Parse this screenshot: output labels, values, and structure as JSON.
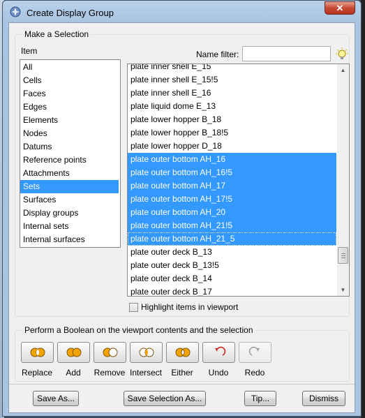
{
  "window": {
    "title": "Create Display Group",
    "close_label": "✕"
  },
  "selection_group": {
    "label": "Make a Selection",
    "item_label": "Item",
    "items": [
      "All",
      "Cells",
      "Faces",
      "Edges",
      "Elements",
      "Nodes",
      "Datums",
      "Reference points",
      "Attachments",
      "Sets",
      "Surfaces",
      "Display groups",
      "Internal sets",
      "Internal surfaces"
    ],
    "selected_item": "Sets",
    "name_filter_label": "Name filter:",
    "name_filter_value": "",
    "sets": [
      "plate inner shell E_15",
      "plate inner shell E_15!5",
      "plate inner shell E_16",
      "plate liquid dome E_13",
      "plate lower hopper B_18",
      "plate lower hopper B_18!5",
      "plate lower hopper D_18",
      "plate outer bottom AH_16",
      "plate outer bottom AH_16!5",
      "plate outer bottom AH_17",
      "plate outer bottom AH_17!5",
      "plate outer bottom AH_20",
      "plate outer bottom AH_21!5",
      "plate outer bottom AH_21_5",
      "plate outer deck B_13",
      "plate outer deck B_13!5",
      "plate outer deck B_14",
      "plate outer deck B_17"
    ],
    "selected_sets": [
      "plate outer bottom AH_16",
      "plate outer bottom AH_16!5",
      "plate outer bottom AH_17",
      "plate outer bottom AH_17!5",
      "plate outer bottom AH_20",
      "plate outer bottom AH_21!5",
      "plate outer bottom AH_21_5"
    ],
    "highlight_label": "Highlight items in viewport",
    "highlight_checked": false
  },
  "boolean_group": {
    "label": "Perform a Boolean on the viewport contents and the selection",
    "buttons": [
      {
        "label": "Replace",
        "icon": "replace-icon"
      },
      {
        "label": "Add",
        "icon": "add-union-icon"
      },
      {
        "label": "Remove",
        "icon": "remove-icon"
      },
      {
        "label": "Intersect",
        "icon": "intersect-icon"
      },
      {
        "label": "Either",
        "icon": "either-icon"
      },
      {
        "label": "Undo",
        "icon": "undo-icon"
      },
      {
        "label": "Redo",
        "icon": "redo-icon"
      }
    ]
  },
  "footer": {
    "save_as": "Save As...",
    "save_selection_as": "Save Selection As...",
    "tip": "Tip...",
    "dismiss": "Dismiss"
  },
  "colors": {
    "selection": "#3399ff",
    "venn_fill": "#f5a300",
    "undo_red": "#c8281e"
  }
}
